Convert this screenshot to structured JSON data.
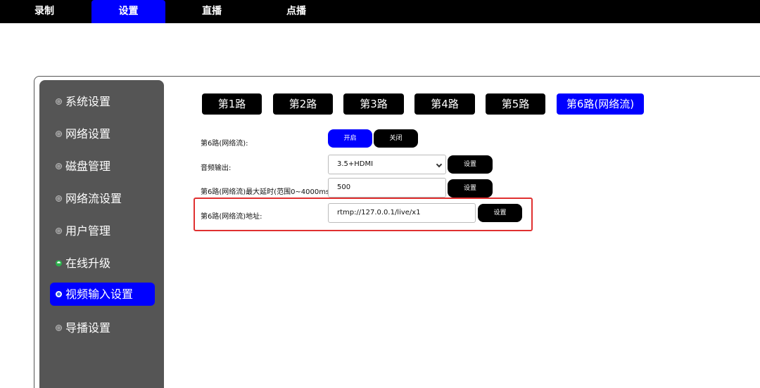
{
  "topnav": {
    "tabs": [
      {
        "label": "录制"
      },
      {
        "label": "设置"
      },
      {
        "label": "直播"
      },
      {
        "label": "点播"
      }
    ],
    "active_color": "#0000ff"
  },
  "sidebar": {
    "items": [
      {
        "label": "系统设置"
      },
      {
        "label": "网络设置"
      },
      {
        "label": "磁盘管理"
      },
      {
        "label": "网络流设置"
      },
      {
        "label": "用户管理"
      },
      {
        "label": "在线升级"
      },
      {
        "label": "视频输入设置"
      },
      {
        "label": "导播设置"
      }
    ],
    "active_index": 6
  },
  "channels": {
    "tabs": [
      {
        "label": "第1路"
      },
      {
        "label": "第2路"
      },
      {
        "label": "第3路"
      },
      {
        "label": "第4路"
      },
      {
        "label": "第5路"
      },
      {
        "label": "第6路(网络流)"
      }
    ],
    "active_index": 5
  },
  "form": {
    "enable": {
      "label": "第6路(网络流):",
      "on_label": "开启",
      "off_label": "关闭",
      "selected": "开启"
    },
    "audio": {
      "label": "音频输出:",
      "value": "3.5+HDMI",
      "button": "设置"
    },
    "delay": {
      "label": "第6路(网络流)最大延时(范围0~4000ms)",
      "value": "500",
      "button": "设置"
    },
    "address": {
      "label": "第6路(网络流)地址:",
      "value": "rtmp://127.0.0.1/live/x1",
      "button": "设置"
    }
  },
  "colors": {
    "accent": "#0000ff",
    "sidebar_bg": "#555555",
    "highlight": "#e03030"
  }
}
